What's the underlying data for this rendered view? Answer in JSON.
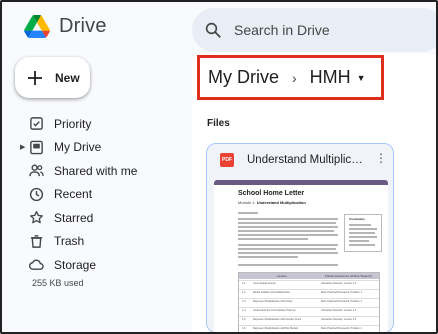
{
  "app": {
    "name": "Drive"
  },
  "search": {
    "placeholder": "Search in Drive"
  },
  "new_button": {
    "label": "New"
  },
  "sidebar": {
    "items": [
      {
        "label": "Priority",
        "icon": "priority-icon"
      },
      {
        "label": "My Drive",
        "icon": "my-drive-icon",
        "expandable": true
      },
      {
        "label": "Shared with me",
        "icon": "shared-icon"
      },
      {
        "label": "Recent",
        "icon": "clock-icon"
      },
      {
        "label": "Starred",
        "icon": "star-icon"
      },
      {
        "label": "Trash",
        "icon": "trash-icon"
      },
      {
        "label": "Storage",
        "icon": "cloud-icon"
      }
    ],
    "storage_used": "255 KB used"
  },
  "breadcrumb": {
    "root": "My Drive",
    "separator": "›",
    "current": "HMH"
  },
  "files": {
    "section_label": "Files",
    "items": [
      {
        "name": "Understand Multiplicati...",
        "type_badge": "PDF",
        "thumbnail": {
          "title": "School Home Letter",
          "module_label": "Module 1:",
          "module_name": "Understand Multiplication",
          "vocab_title": "Vocabulary",
          "table_headers": [
            "Lesson",
            "Family Resources (Online Support)"
          ],
          "rows": [
            {
              "num": "1.1",
              "lesson": "Count Equal Groups",
              "resource": "Interactive Reteach, Lesson 1.1"
            },
            {
              "num": "1.2",
              "lesson": "Relate Addition and Multiplication",
              "resource": "More Practice/Homework, Problem 1"
            },
            {
              "num": "1.3",
              "lesson": "Represent Multiplication with Arrays",
              "resource": "More Practice/Homework, Problem 1"
            },
            {
              "num": "1.4",
              "lesson": "Understand the Commutative Property",
              "resource": "Interactive Reteach, Lesson 1.4"
            },
            {
              "num": "1.5",
              "lesson": "Represent Multiplication with Number Lines",
              "resource": "Interactive Reteach, Lesson 1.5"
            },
            {
              "num": "1.6",
              "lesson": "Represent Multiplication with Bar Models",
              "resource": "More Practice/Homework, Problem 1"
            }
          ]
        }
      }
    ]
  },
  "colors": {
    "highlight_border": "#e02e1e",
    "card_border": "#a8c7fa",
    "pdf_badge": "#ea4335"
  }
}
